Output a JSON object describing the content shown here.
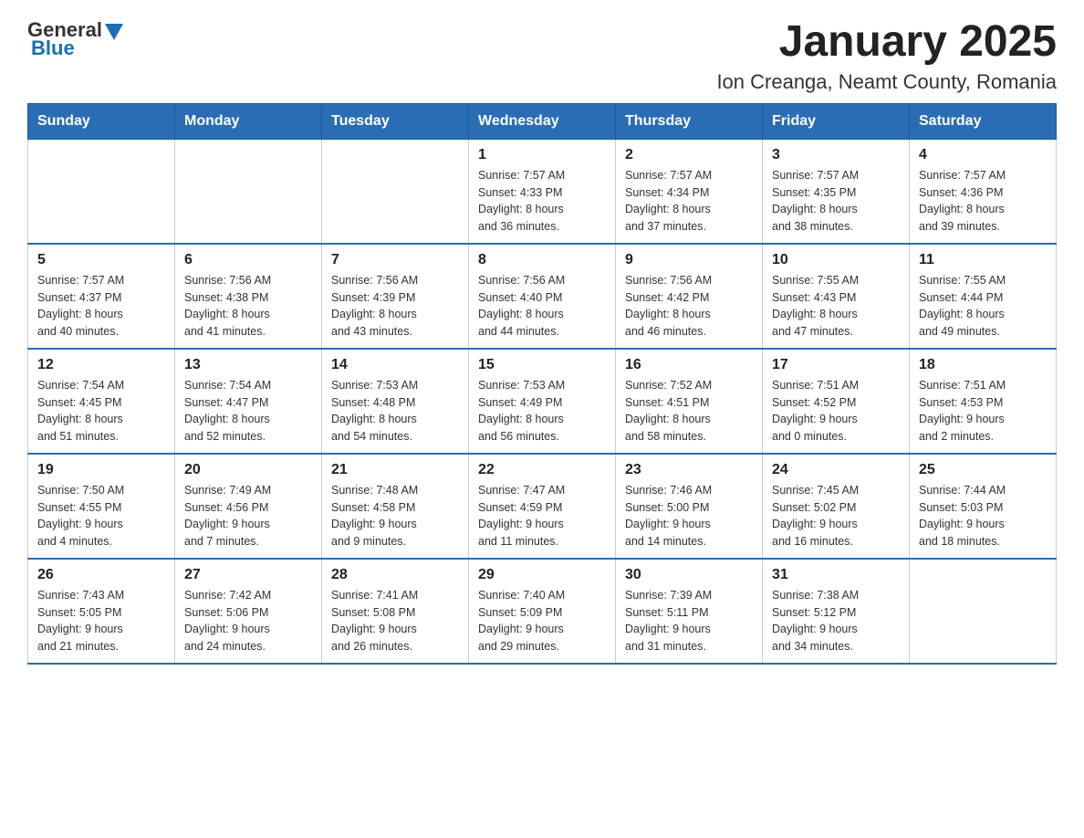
{
  "header": {
    "logo_general": "General",
    "logo_blue": "Blue",
    "title": "January 2025",
    "subtitle": "Ion Creanga, Neamt County, Romania"
  },
  "columns": [
    "Sunday",
    "Monday",
    "Tuesday",
    "Wednesday",
    "Thursday",
    "Friday",
    "Saturday"
  ],
  "weeks": [
    [
      {
        "day": "",
        "info": ""
      },
      {
        "day": "",
        "info": ""
      },
      {
        "day": "",
        "info": ""
      },
      {
        "day": "1",
        "info": "Sunrise: 7:57 AM\nSunset: 4:33 PM\nDaylight: 8 hours\nand 36 minutes."
      },
      {
        "day": "2",
        "info": "Sunrise: 7:57 AM\nSunset: 4:34 PM\nDaylight: 8 hours\nand 37 minutes."
      },
      {
        "day": "3",
        "info": "Sunrise: 7:57 AM\nSunset: 4:35 PM\nDaylight: 8 hours\nand 38 minutes."
      },
      {
        "day": "4",
        "info": "Sunrise: 7:57 AM\nSunset: 4:36 PM\nDaylight: 8 hours\nand 39 minutes."
      }
    ],
    [
      {
        "day": "5",
        "info": "Sunrise: 7:57 AM\nSunset: 4:37 PM\nDaylight: 8 hours\nand 40 minutes."
      },
      {
        "day": "6",
        "info": "Sunrise: 7:56 AM\nSunset: 4:38 PM\nDaylight: 8 hours\nand 41 minutes."
      },
      {
        "day": "7",
        "info": "Sunrise: 7:56 AM\nSunset: 4:39 PM\nDaylight: 8 hours\nand 43 minutes."
      },
      {
        "day": "8",
        "info": "Sunrise: 7:56 AM\nSunset: 4:40 PM\nDaylight: 8 hours\nand 44 minutes."
      },
      {
        "day": "9",
        "info": "Sunrise: 7:56 AM\nSunset: 4:42 PM\nDaylight: 8 hours\nand 46 minutes."
      },
      {
        "day": "10",
        "info": "Sunrise: 7:55 AM\nSunset: 4:43 PM\nDaylight: 8 hours\nand 47 minutes."
      },
      {
        "day": "11",
        "info": "Sunrise: 7:55 AM\nSunset: 4:44 PM\nDaylight: 8 hours\nand 49 minutes."
      }
    ],
    [
      {
        "day": "12",
        "info": "Sunrise: 7:54 AM\nSunset: 4:45 PM\nDaylight: 8 hours\nand 51 minutes."
      },
      {
        "day": "13",
        "info": "Sunrise: 7:54 AM\nSunset: 4:47 PM\nDaylight: 8 hours\nand 52 minutes."
      },
      {
        "day": "14",
        "info": "Sunrise: 7:53 AM\nSunset: 4:48 PM\nDaylight: 8 hours\nand 54 minutes."
      },
      {
        "day": "15",
        "info": "Sunrise: 7:53 AM\nSunset: 4:49 PM\nDaylight: 8 hours\nand 56 minutes."
      },
      {
        "day": "16",
        "info": "Sunrise: 7:52 AM\nSunset: 4:51 PM\nDaylight: 8 hours\nand 58 minutes."
      },
      {
        "day": "17",
        "info": "Sunrise: 7:51 AM\nSunset: 4:52 PM\nDaylight: 9 hours\nand 0 minutes."
      },
      {
        "day": "18",
        "info": "Sunrise: 7:51 AM\nSunset: 4:53 PM\nDaylight: 9 hours\nand 2 minutes."
      }
    ],
    [
      {
        "day": "19",
        "info": "Sunrise: 7:50 AM\nSunset: 4:55 PM\nDaylight: 9 hours\nand 4 minutes."
      },
      {
        "day": "20",
        "info": "Sunrise: 7:49 AM\nSunset: 4:56 PM\nDaylight: 9 hours\nand 7 minutes."
      },
      {
        "day": "21",
        "info": "Sunrise: 7:48 AM\nSunset: 4:58 PM\nDaylight: 9 hours\nand 9 minutes."
      },
      {
        "day": "22",
        "info": "Sunrise: 7:47 AM\nSunset: 4:59 PM\nDaylight: 9 hours\nand 11 minutes."
      },
      {
        "day": "23",
        "info": "Sunrise: 7:46 AM\nSunset: 5:00 PM\nDaylight: 9 hours\nand 14 minutes."
      },
      {
        "day": "24",
        "info": "Sunrise: 7:45 AM\nSunset: 5:02 PM\nDaylight: 9 hours\nand 16 minutes."
      },
      {
        "day": "25",
        "info": "Sunrise: 7:44 AM\nSunset: 5:03 PM\nDaylight: 9 hours\nand 18 minutes."
      }
    ],
    [
      {
        "day": "26",
        "info": "Sunrise: 7:43 AM\nSunset: 5:05 PM\nDaylight: 9 hours\nand 21 minutes."
      },
      {
        "day": "27",
        "info": "Sunrise: 7:42 AM\nSunset: 5:06 PM\nDaylight: 9 hours\nand 24 minutes."
      },
      {
        "day": "28",
        "info": "Sunrise: 7:41 AM\nSunset: 5:08 PM\nDaylight: 9 hours\nand 26 minutes."
      },
      {
        "day": "29",
        "info": "Sunrise: 7:40 AM\nSunset: 5:09 PM\nDaylight: 9 hours\nand 29 minutes."
      },
      {
        "day": "30",
        "info": "Sunrise: 7:39 AM\nSunset: 5:11 PM\nDaylight: 9 hours\nand 31 minutes."
      },
      {
        "day": "31",
        "info": "Sunrise: 7:38 AM\nSunset: 5:12 PM\nDaylight: 9 hours\nand 34 minutes."
      },
      {
        "day": "",
        "info": ""
      }
    ]
  ]
}
